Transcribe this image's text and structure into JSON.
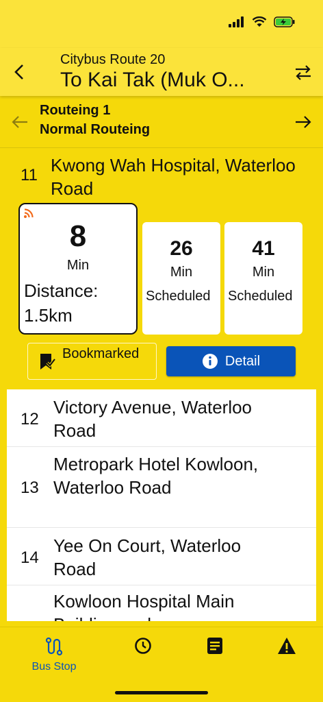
{
  "header": {
    "route_title": "Citybus Route 20",
    "destination": "To Kai Tak (Muk O..."
  },
  "routeing": {
    "name": "Routeing 1",
    "description": "Normal Routeing"
  },
  "current_stop": {
    "seq": "11",
    "name": "Kwong Wah Hospital, Waterloo Road",
    "eta_main": {
      "minutes": "8",
      "unit": "Min",
      "distance": "Distance: 1.5km",
      "realtime": true
    },
    "eta_scheduled": [
      {
        "minutes": "26",
        "unit": "Min",
        "note": "Scheduled"
      },
      {
        "minutes": "41",
        "unit": "Min",
        "note": "Scheduled"
      }
    ],
    "bookmark_label": "Bookmarked",
    "detail_label": "Detail"
  },
  "stops": [
    {
      "seq": "12",
      "name": "Victory Avenue, Waterloo Road"
    },
    {
      "seq": "13",
      "name": "Metropark Hotel Kowloon, Waterloo Road"
    },
    {
      "seq": "14",
      "name": "Yee On Court, Waterloo Road"
    },
    {
      "seq": "",
      "name": "Kowloon Hospital Main Building and"
    }
  ],
  "nav": {
    "bus_stop_label": "Bus Stop",
    "active": "bus-stop"
  },
  "colors": {
    "background": "#F5D90A",
    "header": "#FBE33A",
    "accent_blue": "#0A54B8",
    "realtime_orange": "#F26B1D"
  }
}
